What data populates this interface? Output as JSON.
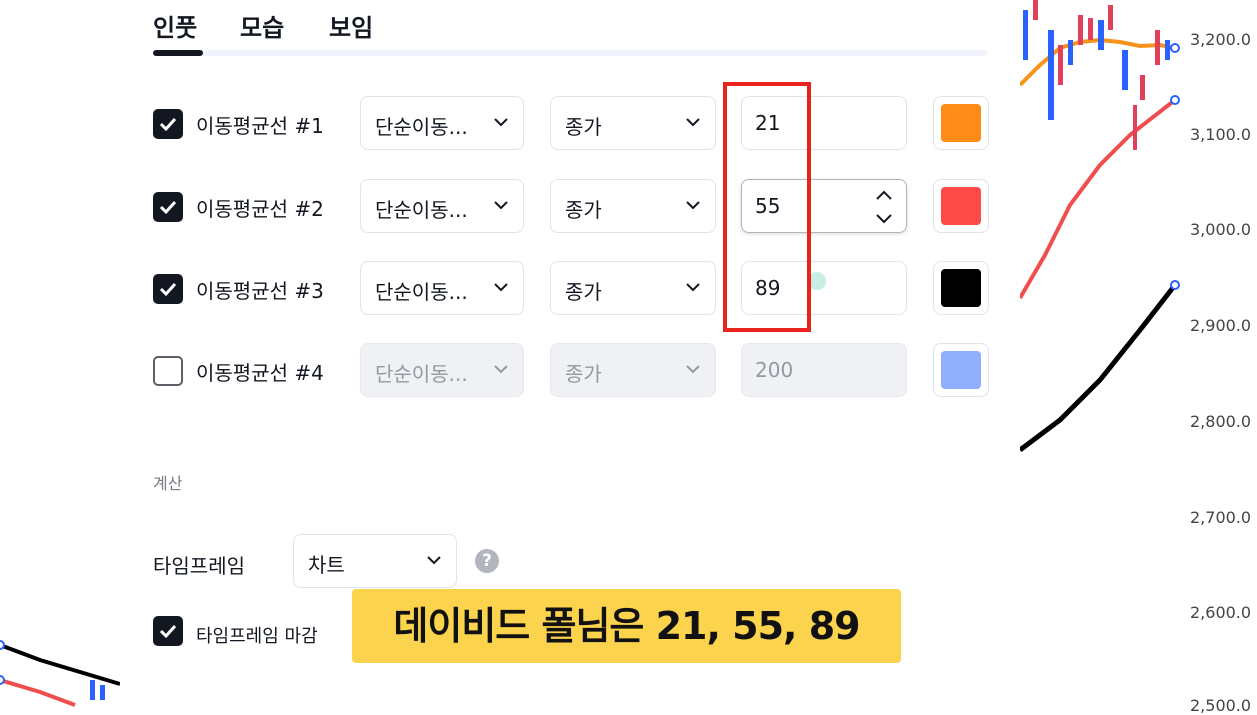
{
  "tabs": [
    {
      "label": "인풋",
      "active": true
    },
    {
      "label": "모습",
      "active": false
    },
    {
      "label": "보임",
      "active": false
    }
  ],
  "moving_averages": [
    {
      "label": "이동평균선 #1",
      "checked": true,
      "type": "단순이동...",
      "source": "종가",
      "length": "21",
      "color": "#ff8c16",
      "enabled": true
    },
    {
      "label": "이동평균선 #2",
      "checked": true,
      "type": "단순이동...",
      "source": "종가",
      "length": "55",
      "color": "#ff4a4a",
      "enabled": true
    },
    {
      "label": "이동평균선 #3",
      "checked": true,
      "type": "단순이동...",
      "source": "종가",
      "length": "89",
      "color": "#000000",
      "enabled": true
    },
    {
      "label": "이동평균선 #4",
      "checked": false,
      "type": "단순이동...",
      "source": "종가",
      "length": "200",
      "color": "#90aefc",
      "enabled": false
    }
  ],
  "calc_section_label": "계산",
  "timeframe": {
    "label": "타임프레임",
    "value": "차트",
    "help_icon": "question-icon"
  },
  "timeframe_close": {
    "label": "타임프레임 마감",
    "checked": true
  },
  "caption": "데이비드 폴님은 21, 55, 89",
  "price_axis": [
    "3,200.0",
    "3,100.0",
    "3,000.0",
    "2,900.0",
    "2,800.0",
    "2,700.0",
    "2,600.0",
    "2,500.0"
  ],
  "colors": {
    "highlight_box": "#e8231c",
    "caption_bg": "#fcd34d",
    "up_candle": "#2962ff",
    "down_candle": "#e0405a"
  }
}
